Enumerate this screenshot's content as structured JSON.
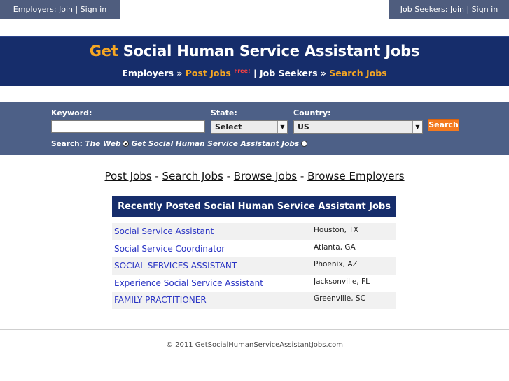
{
  "topbar": {
    "employers_text": "Employers: Join | Sign in",
    "jobseekers_text": "Job Seekers: Join | Sign in"
  },
  "banner": {
    "title_get": "Get",
    "title_rest": "Social Human Service Assistant Jobs",
    "nav_employers": "Employers »",
    "nav_post_jobs": "Post Jobs",
    "nav_free": "Free!",
    "nav_sep": "|",
    "nav_jobseekers": "Job Seekers »",
    "nav_search_jobs": "Search Jobs"
  },
  "search": {
    "keyword_label": "Keyword:",
    "keyword_value": "",
    "state_label": "State:",
    "state_value": "Select",
    "country_label": "Country:",
    "country_value": "US",
    "button": "Search",
    "search_prefix": "Search:",
    "option_web": "The Web",
    "option_site": "Get Social Human Service Assistant Jobs"
  },
  "links": {
    "post_jobs": "Post Jobs",
    "search_jobs": "Search Jobs",
    "browse_jobs": "Browse Jobs",
    "browse_employers": "Browse Employers",
    "sep": "-"
  },
  "jobs": {
    "heading": "Recently Posted Social Human Service Assistant Jobs",
    "items": [
      {
        "title": "Social Service Assistant",
        "location": "Houston, TX"
      },
      {
        "title": "Social Service Coordinator",
        "location": "Atlanta, GA"
      },
      {
        "title": "SOCIAL SERVICES ASSISTANT",
        "location": "Phoenix, AZ"
      },
      {
        "title": "Experience Social Service Assistant",
        "location": "Jacksonville, FL"
      },
      {
        "title": "FAMILY PRACTITIONER",
        "location": "Greenville, SC"
      }
    ]
  },
  "footer": {
    "copyright": "© 2011 GetSocialHumanServiceAssistantJobs.com"
  },
  "colors": {
    "navy": "#162d6b",
    "slate": "#4d6087",
    "orange": "#f5a623",
    "link_blue": "#2b35c4"
  }
}
